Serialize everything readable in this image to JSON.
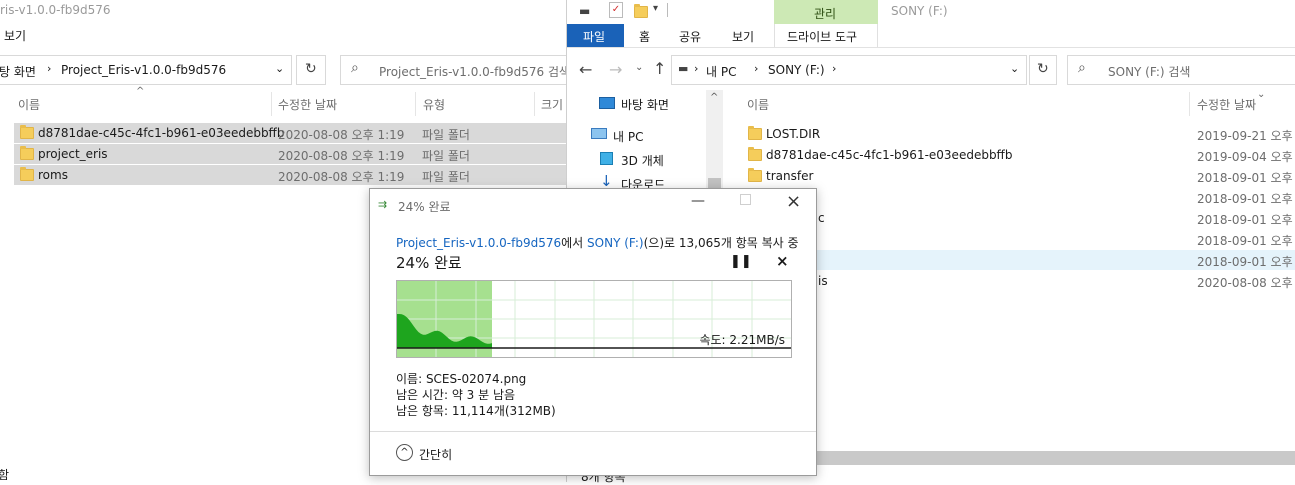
{
  "left": {
    "title": "ris-v1.0.0-fb9d576",
    "menu_view": "보기",
    "breadcrumb": {
      "root": "탕 화면",
      "current": "Project_Eris-v1.0.0-fb9d576"
    },
    "search_placeholder": "Project_Eris-v1.0.0-fb9d576 검색",
    "columns": {
      "name": "이름",
      "date": "수정한 날짜",
      "type": "유형",
      "size": "크기"
    },
    "rows": [
      {
        "name": "d8781dae-c45c-4fc1-b961-e03eedebbffb",
        "date": "2020-08-08 오후 1:19",
        "type": "파일 폴더"
      },
      {
        "name": "project_eris",
        "date": "2020-08-08 오후 1:19",
        "type": "파일 폴더"
      },
      {
        "name": "roms",
        "date": "2020-08-08 오후 1:19",
        "type": "파일 폴더"
      }
    ],
    "status_partial": "함"
  },
  "right": {
    "ribbon_context": "관리",
    "window_title": "SONY (F:)",
    "tabs": {
      "file": "파일",
      "home": "홈",
      "share": "공유",
      "view": "보기",
      "drive_tools": "드라이브 도구"
    },
    "path": {
      "pc": "내 PC",
      "drive": "SONY (F:)"
    },
    "search_placeholder": "SONY (F:) 검색",
    "nav": {
      "desktop": "바탕 화면",
      "this_pc": "내 PC",
      "objects3d": "3D 개체",
      "downloads": "다운로드"
    },
    "columns": {
      "name": "이름",
      "date": "수정한 날짜"
    },
    "rows": [
      {
        "name": "LOST.DIR",
        "date": "2019-09-21 오후"
      },
      {
        "name": "d8781dae-c45c-4fc1-b961-e03eedebbffb",
        "date": "2019-09-04 오후"
      },
      {
        "name": "transfer",
        "date": "2018-09-01 오후"
      },
      {
        "name": "",
        "date": "2018-09-01 오후"
      },
      {
        "name": "c",
        "date": "2018-09-01 오후"
      },
      {
        "name": "",
        "date": "2018-09-01 오후"
      },
      {
        "name": "",
        "date": "2018-09-01 오후"
      },
      {
        "name": "is",
        "date": "2020-08-08 오후"
      }
    ],
    "status": "8개 항목"
  },
  "dialog": {
    "title": "24% 완료",
    "source": "Project_Eris-v1.0.0-fb9d576",
    "from_text": "에서 ",
    "dest": "SONY (F:)",
    "copy_text": "(으)로 13,065개 항목 복사 중",
    "heading": "24% 완료",
    "speed": "속도: 2.21MB/s",
    "progress": 0.24,
    "file_name": "이름: SCES-02074.png",
    "time_left": "남은 시간: 약 3 분 남음",
    "items_left": "남은 항목: 11,114개(312MB)",
    "less_details": "간단히",
    "colors": {
      "progress": "#a6e08f",
      "graph": "#1ea51e",
      "link": "#1565c0"
    }
  }
}
